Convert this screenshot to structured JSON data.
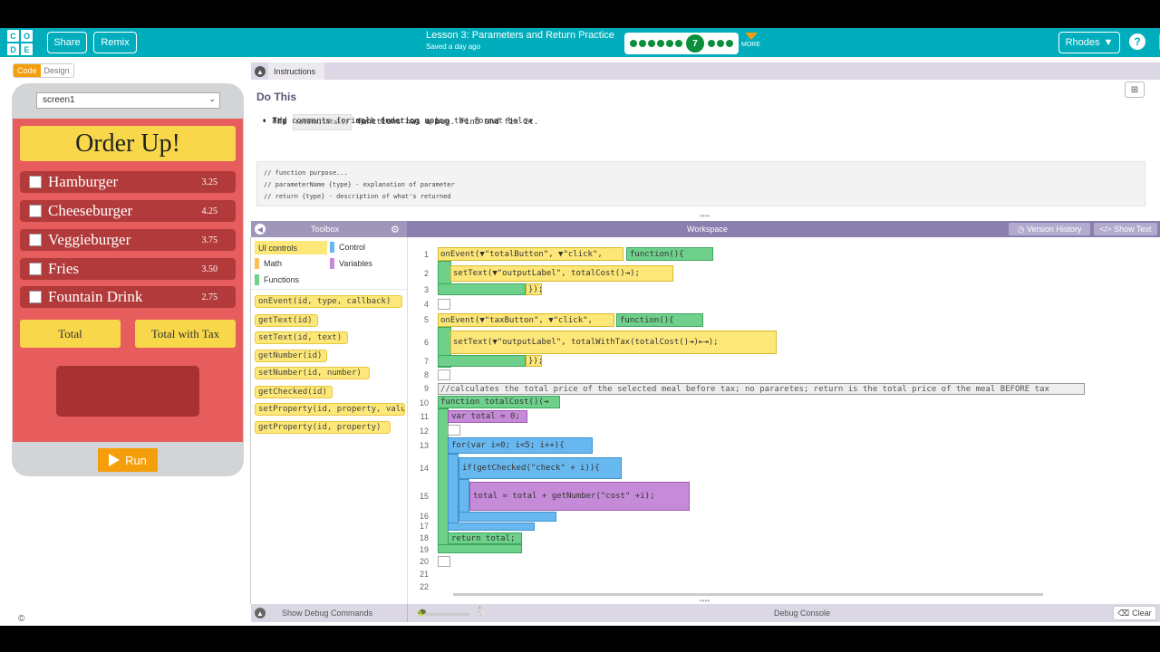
{
  "header": {
    "logo_letters": [
      "C",
      "O",
      "D",
      "E"
    ],
    "share_label": "Share",
    "remix_label": "Remix",
    "lesson_title": "Lesson 3: Parameters and Return Practice",
    "save_status": "Saved a day ago",
    "current_level": "7",
    "more_label": "MORE",
    "user_name": "Rhodes"
  },
  "left": {
    "code_tab": "Code",
    "design_tab": "Design",
    "screen_select": "screen1",
    "run_label": "Run"
  },
  "app": {
    "title": "Order Up!",
    "items": [
      {
        "name": "Hamburger",
        "price": "3.25"
      },
      {
        "name": "Cheeseburger",
        "price": "4.25"
      },
      {
        "name": "Veggieburger",
        "price": "3.75"
      },
      {
        "name": "Fries",
        "price": "3.50"
      },
      {
        "name": "Fountain Drink",
        "price": "2.75"
      }
    ],
    "total_button": "Total",
    "tax_button": "Total with Tax"
  },
  "instructions": {
    "tab_label": "Instructions",
    "heading": "Do This",
    "bullets": [
      "Try using this simple ordering app.",
      "",
      "Add comments for each function using the format below"
    ],
    "bullet2_prefix": "The",
    "bullet2_code": "totalWithTax()",
    "bullet2_suffix": "functions has a bug. Find and fix it.",
    "comment_lines": [
      "// function purpose...",
      "// parameterName {type} - explanation of parameter",
      "// return {type} - description of what's returned"
    ]
  },
  "toolbox": {
    "title": "Toolbox",
    "categories": [
      "UI controls",
      "Control",
      "Math",
      "Variables",
      "Functions"
    ],
    "blocks": [
      "onEvent(id, type, callback)",
      "getText(id)",
      "setText(id, text)",
      "getNumber(id)",
      "setNumber(id, number)",
      "getChecked(id)",
      "setProperty(id, property, value)",
      "getProperty(id, property)"
    ]
  },
  "workspace": {
    "title": "Workspace",
    "version_history": "Version History",
    "show_text": "Show Text",
    "line_numbers": [
      "1",
      "2",
      "3",
      "4",
      "5",
      "6",
      "7",
      "8",
      "9",
      "10",
      "11",
      "12",
      "13",
      "14",
      "15",
      "16",
      "17",
      "18",
      "19",
      "20",
      "21",
      "22"
    ]
  },
  "code": {
    "l1": "onEvent(▼\"totalButton\", ▼\"click\",",
    "l1_fn": "function(){",
    "l2": "setText(▼\"outputLabel\", totalCost()⇥);",
    "close": "});",
    "l5": "onEvent(▼\"taxButton\", ▼\"click\",",
    "l6": "setText(▼\"outputLabel\", totalWithTax(totalCost()⇥)⇤⇥);",
    "l9": "//calculates the total price of the selected meal before tax; no pararetes; return is the total price of the meal BEFORE tax",
    "l10": "function totalCost()(⇥",
    "l11": "var total = 0;",
    "l13": "for(var i=0; i<5; i++){",
    "l14": "if(getChecked(\"check\" + i)){",
    "l15": "total = total + getNumber(\"cost\" +i);",
    "l18": "return total;"
  },
  "debug": {
    "show_commands": "Show Debug Commands",
    "console_label": "Debug Console",
    "clear_label": "Clear"
  },
  "colors": {
    "topbar": "#00adbc",
    "app_background": "#e75c5c",
    "app_title_bg": "#f8d84a",
    "item_bg": "#b23a3a",
    "run_button": "#f59e0b",
    "workspace_header": "#8a7fae"
  }
}
